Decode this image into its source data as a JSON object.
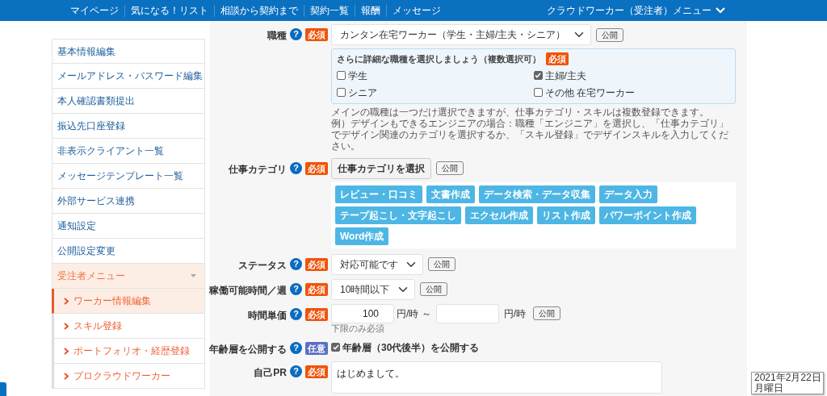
{
  "top_nav": {
    "items": [
      "マイページ",
      "気になる！リスト",
      "相談から契約まで",
      "契約一覧",
      "報酬",
      "メッセージ"
    ],
    "menu": "クラウドワーカー（受注者）メニュー"
  },
  "sidebar": {
    "items": [
      {
        "label": "基本情報編集",
        "kind": "main",
        "selected": false
      },
      {
        "label": "メールアドレス・パスワード編集",
        "kind": "main",
        "selected": false
      },
      {
        "label": "本人確認書類提出",
        "kind": "main",
        "selected": false
      },
      {
        "label": "振込先口座登録",
        "kind": "main",
        "selected": false
      },
      {
        "label": "非表示クライアント一覧",
        "kind": "main",
        "selected": false
      },
      {
        "label": "メッセージテンプレート一覧",
        "kind": "main",
        "selected": false
      },
      {
        "label": "外部サービス連携",
        "kind": "main",
        "selected": false
      },
      {
        "label": "通知設定",
        "kind": "main",
        "selected": false
      },
      {
        "label": "公開設定変更",
        "kind": "main",
        "selected": false
      },
      {
        "label": "受注者メニュー",
        "kind": "group",
        "expanded": true,
        "children": [
          {
            "label": "ワーカー情報編集",
            "selected": true
          },
          {
            "label": "スキル登録",
            "selected": false
          },
          {
            "label": "ポートフォリオ・経歴登録",
            "selected": false
          },
          {
            "label": "プロクラウドワーカー",
            "selected": false
          }
        ]
      }
    ]
  },
  "form": {
    "rows": [
      {
        "kind": "select",
        "label": "職種",
        "help": "?",
        "badge": {
          "text": "必須",
          "kind": "required"
        },
        "value": "カンタン在宅ワーカー（学生・主婦/主夫・シニア）",
        "publish": "公開",
        "detail": {
          "title": "さらに詳細な職種を選択しましょう（複数選択可）",
          "badge": {
            "text": "必須",
            "kind": "required"
          },
          "options": [
            {
              "label": "学生",
              "checked": false
            },
            {
              "label": "主婦/主夫",
              "checked": true
            },
            {
              "label": "シニア",
              "checked": false
            },
            {
              "label": "その他 在宅ワーカー",
              "checked": false
            }
          ]
        },
        "notes": [
          "メインの職種は一つだけ選択できますが、仕事カテゴリ・スキルは複数登録できます。",
          "例）デザインもできるエンジニアの場合：職種「エンジニア」を選択し、「仕事カテゴリ」でデザイン関連のカテゴリを選択するか、「スキル登録」でデザインスキルを入力してください。"
        ]
      },
      {
        "kind": "tags",
        "label": "仕事カテゴリ",
        "help": "?",
        "badge": {
          "text": "必須",
          "kind": "required"
        },
        "button": "仕事カテゴリを選択",
        "publish": "公開",
        "tags": [
          "レビュー・口コミ",
          "文書作成",
          "データ検索・データ収集",
          "データ入力",
          "テープ起こし・文字起こし",
          "エクセル作成",
          "リスト作成",
          "パワーポイント作成",
          "Word作成"
        ]
      },
      {
        "kind": "select",
        "label": "ステータス",
        "help": "?",
        "badge": {
          "text": "必須",
          "kind": "required"
        },
        "value": "対応可能です",
        "publish": "公開"
      },
      {
        "kind": "select",
        "label": "稼働可能時間／週",
        "help": "?",
        "badge": {
          "text": "必須",
          "kind": "required"
        },
        "value": "10時間以下",
        "publish": "公開"
      },
      {
        "kind": "range",
        "label": "時間単価",
        "help": "?",
        "badge": {
          "text": "必須",
          "kind": "required"
        },
        "min_value": "100",
        "unit_from": "円/時 ～",
        "unit_to": "円/時",
        "publish": "公開",
        "hint": "下限のみ必須"
      },
      {
        "kind": "checkbox",
        "label": "年齢層を公開する",
        "help": "?",
        "badge": {
          "text": "任意",
          "kind": "optional"
        },
        "option": {
          "label": "年齢層（30代後半）を公開する",
          "checked": true
        }
      },
      {
        "kind": "textarea",
        "label": "自己PR",
        "help": "?",
        "badge": {
          "text": "必須",
          "kind": "required"
        },
        "value": "はじめまして。"
      }
    ]
  },
  "date_tooltip": {
    "date": "2021年2月22日",
    "weekday": "月曜日"
  }
}
